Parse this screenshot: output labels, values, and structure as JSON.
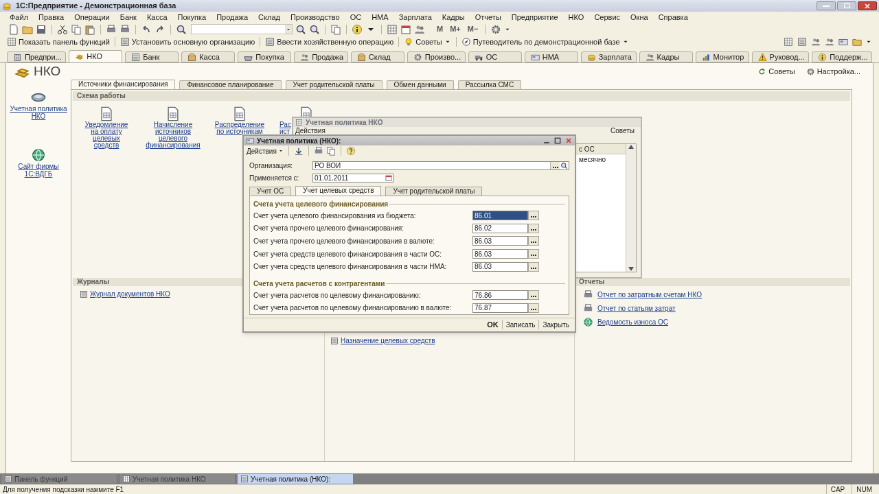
{
  "window": {
    "title": "1С:Предприятие - Демонстрационная база"
  },
  "menu": [
    "Файл",
    "Правка",
    "Операции",
    "Банк",
    "Касса",
    "Покупка",
    "Продажа",
    "Склад",
    "Производство",
    "ОС",
    "НМА",
    "Зарплата",
    "Кадры",
    "Отчеты",
    "Предприятие",
    "НКО",
    "Сервис",
    "Окна",
    "Справка"
  ],
  "memory_buttons": [
    "M",
    "M+",
    "M−"
  ],
  "command_bar": [
    {
      "label": "Показать панель функций",
      "kind": "button"
    },
    {
      "label": "Установить основную организацию",
      "kind": "button"
    },
    {
      "label": "Ввести хозяйственную операцию",
      "kind": "button"
    },
    {
      "label": "Советы",
      "kind": "dropdown"
    },
    {
      "label": "Путеводитель по демонстрационной базе",
      "kind": "dropdown"
    }
  ],
  "section_tabs": [
    {
      "label": "Предпри...",
      "selected": false
    },
    {
      "label": "НКО",
      "selected": true
    },
    {
      "label": "Банк",
      "selected": false
    },
    {
      "label": "Касса",
      "selected": false
    },
    {
      "label": "Покупка",
      "selected": false
    },
    {
      "label": "Продажа",
      "selected": false
    },
    {
      "label": "Склад",
      "selected": false
    },
    {
      "label": "Произво...",
      "selected": false
    },
    {
      "label": "ОС",
      "selected": false
    },
    {
      "label": "НМА",
      "selected": false
    },
    {
      "label": "Зарплата",
      "selected": false
    },
    {
      "label": "Кадры",
      "selected": false
    },
    {
      "label": "Монитор",
      "selected": false
    },
    {
      "label": "Руковод...",
      "selected": false
    },
    {
      "label": "Поддерж...",
      "selected": false
    }
  ],
  "panel": {
    "title": "НКО",
    "links": [
      "Советы",
      "Настройка..."
    ],
    "sidebar": [
      "Учетная политика НКО",
      "Сайт фирмы 1С:ВДГБ"
    ],
    "tabs": [
      {
        "label": "Источники финансирования",
        "selected": true
      },
      {
        "label": "Финансовое планирование",
        "selected": false
      },
      {
        "label": "Учет родительской платы",
        "selected": false
      },
      {
        "label": "Обмен данными",
        "selected": false
      },
      {
        "label": "Рассылка СМС",
        "selected": false
      }
    ],
    "scheme": {
      "title": "Схема работы",
      "items": [
        "Уведомление\nна оплату\nцелевых\nсредств",
        "Начисление\nисточников\nцелевого\nфинансирования",
        "Распределение\nпо источникам",
        "Рас\nист"
      ]
    },
    "journals": {
      "title": "Журналы",
      "links": [
        "Журнал документов НКО"
      ]
    },
    "middle_links": [
      "Назначение целевых средств"
    ],
    "reports": {
      "title": "Отчеты",
      "links": [
        "Отчет по затратным счетам НКО",
        "Отчет по статьям затрат",
        "Ведомость износа ОС"
      ]
    }
  },
  "list_window": {
    "title": "Учетная политика НКО",
    "actions": "Действия",
    "tips": "Советы",
    "column": "с ОС",
    "rows": [
      "месячно"
    ]
  },
  "dialog": {
    "title": "Учетная политика (НКО):",
    "actions": "Действия",
    "organization": {
      "label": "Организация:",
      "value": "РО ВОИ"
    },
    "date": {
      "label": "Применяется с:",
      "value": "01.01.2011"
    },
    "tabs": [
      {
        "label": "Учет ОС",
        "selected": false
      },
      {
        "label": "Учет целевых средств",
        "selected": true
      },
      {
        "label": "Учет родительской платы",
        "selected": false
      }
    ],
    "groups": [
      {
        "title": "Счета учета целевого финансирования",
        "rows": [
          {
            "label": "Счет учета целевого финансирования из бюджета:",
            "value": "86.01",
            "focused": true
          },
          {
            "label": "Счет учета прочего целевого финансирования:",
            "value": "86.02",
            "focused": false
          },
          {
            "label": "Счет учета прочего целевого финансирования в валюте:",
            "value": "86.03",
            "focused": false
          },
          {
            "label": "Счет учета средств целевого финансирования в части ОС:",
            "value": "86.03",
            "focused": false
          },
          {
            "label": "Счет учета средств целевого финансирования в части НМА:",
            "value": "86.03",
            "focused": false
          }
        ]
      },
      {
        "title": "Счета учета расчетов с контрагентами",
        "rows": [
          {
            "label": "Счет учета расчетов по целевому финансированию:",
            "value": "76.86",
            "focused": false
          },
          {
            "label": "Счет учета расчетов по целевому финансированию в валюте:",
            "value": "76.87",
            "focused": false
          }
        ]
      }
    ],
    "buttons": [
      "OK",
      "Записать",
      "Закрыть"
    ]
  },
  "taskbar": [
    {
      "label": "Панель функций",
      "selected": false
    },
    {
      "label": "Учетная политика НКО",
      "selected": false
    },
    {
      "label": "Учетная политика (НКО):",
      "selected": true
    }
  ],
  "status_bar": {
    "hint": "Для получения подсказки нажмите F1",
    "indicators": [
      "CAP",
      "NUM"
    ]
  }
}
